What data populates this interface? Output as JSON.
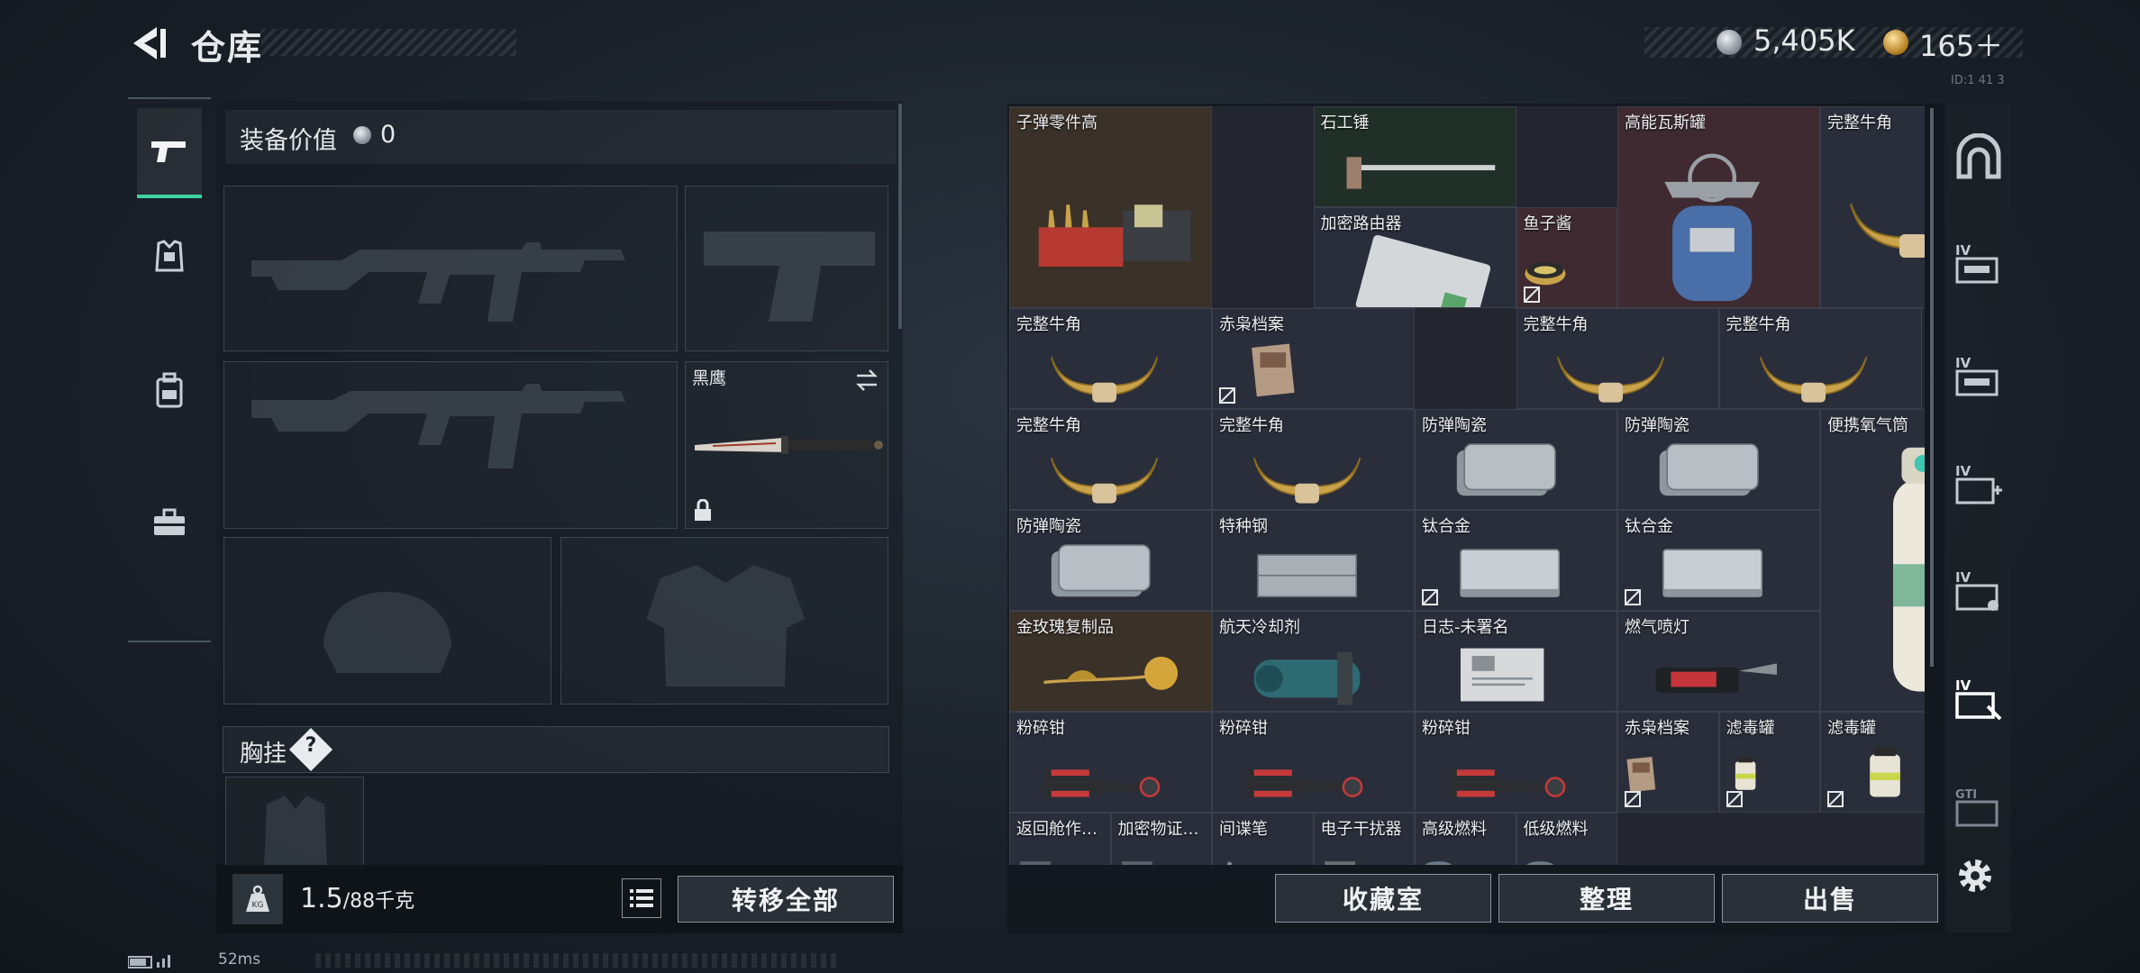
{
  "header": {
    "title": "仓库",
    "currency_silver": "5,405K",
    "currency_gold": "165＋",
    "top_right_text": "ID:1  41 3"
  },
  "tabs_left": [
    "firearm-tab",
    "armor-tab",
    "backpack-tab",
    "toolbox-tab"
  ],
  "equipment": {
    "value_label": "装备价值",
    "value": "0",
    "knife_name": "黑鹰",
    "rig_label": "胸挂",
    "rig_help": "?",
    "weight": "1.5",
    "weight_max": "/88千克",
    "transfer_all": "转移全部"
  },
  "inventory": {
    "items": [
      {
        "label": "子弹零件高",
        "icon": "ammo-parts-icon",
        "bg": "#3a3128"
      },
      {
        "label": "石工锤",
        "icon": "sledgehammer-icon",
        "bg": "#203028"
      },
      {
        "label": "高能瓦斯罐",
        "icon": "gas-canister-icon",
        "bg": "#3e2a30"
      },
      {
        "label": "完整牛角",
        "icon": "horn-icon",
        "bg": "#2a2e3b"
      },
      {
        "label": "加密路由器",
        "icon": "router-icon",
        "bg": "#2a2e3b"
      },
      {
        "label": "鱼子酱",
        "icon": "caviar-icon",
        "bg": "#3e2a30"
      },
      {
        "label": "完整牛角",
        "icon": "horn-icon",
        "bg": "#2a2e3b"
      },
      {
        "label": "赤枭档案",
        "icon": "file-icon",
        "bg": "#2a2e3b"
      },
      {
        "label": "完整牛角",
        "icon": "horn-icon",
        "bg": "#2a2e3b"
      },
      {
        "label": "完整牛角",
        "icon": "horn-icon",
        "bg": "#2a2e3b"
      },
      {
        "label": "完整牛角",
        "icon": "horn-icon",
        "bg": "#2a2e3b"
      },
      {
        "label": "完整牛角",
        "icon": "horn-icon",
        "bg": "#2a2e3b"
      },
      {
        "label": "防弹陶瓷",
        "icon": "ceramic-plate-icon",
        "bg": "#2a2e3b"
      },
      {
        "label": "防弹陶瓷",
        "icon": "ceramic-plate-icon",
        "bg": "#2a2e3b"
      },
      {
        "label": "便携氧气筒",
        "icon": "oxygen-tank-icon",
        "bg": "#2a2e3b"
      },
      {
        "label": "防弹陶瓷",
        "icon": "ceramic-plate-icon",
        "bg": "#2a2e3b"
      },
      {
        "label": "特种钢",
        "icon": "steel-icon",
        "bg": "#2a2e3b"
      },
      {
        "label": "钛合金",
        "icon": "titanium-icon",
        "bg": "#2a2e3b"
      },
      {
        "label": "钛合金",
        "icon": "titanium-icon",
        "bg": "#2a2e3b"
      },
      {
        "label": "金玫瑰复制品",
        "icon": "gold-rose-icon",
        "bg": "#3a3128"
      },
      {
        "label": "航天冷却剂",
        "icon": "coolant-icon",
        "bg": "#2a2e3b"
      },
      {
        "label": "日志-未署名",
        "icon": "log-icon",
        "bg": "#2a2e3b"
      },
      {
        "label": "燃气喷灯",
        "icon": "torch-icon",
        "bg": "#2a2e3b"
      },
      {
        "label": "粉碎钳",
        "icon": "bolt-cutter-icon",
        "bg": "#2a2e3b"
      },
      {
        "label": "粉碎钳",
        "icon": "bolt-cutter-icon",
        "bg": "#2a2e3b"
      },
      {
        "label": "粉碎钳",
        "icon": "bolt-cutter-icon",
        "bg": "#2a2e3b"
      },
      {
        "label": "赤枭档案",
        "icon": "file-icon",
        "bg": "#2a2e3b"
      },
      {
        "label": "滤毒罐",
        "icon": "filter-canister-icon",
        "bg": "#2a2e3b"
      },
      {
        "label": "滤毒罐",
        "icon": "filter-canister-icon",
        "bg": "#2a2e3b"
      },
      {
        "label": "返回舱作…",
        "icon": "item-icon",
        "bg": "#2a2e3b"
      },
      {
        "label": "加密物证…",
        "icon": "item-icon",
        "bg": "#2a2e3b"
      },
      {
        "label": "间谍笔",
        "icon": "pen-icon",
        "bg": "#2a2e3b"
      },
      {
        "label": "电子干扰器",
        "icon": "jammer-icon",
        "bg": "#2a2e3b"
      },
      {
        "label": "高级燃料",
        "icon": "fuel-icon",
        "bg": "#2a2e3b"
      },
      {
        "label": "低级燃料",
        "icon": "fuel-icon",
        "bg": "#2a2e3b"
      }
    ],
    "buttons": {
      "vault": "收藏室",
      "sort": "整理",
      "sell": "出售"
    }
  },
  "status": {
    "ping": "52ms"
  },
  "colors": {
    "accent": "#3ed2a0",
    "gold": "#c9a24a"
  }
}
